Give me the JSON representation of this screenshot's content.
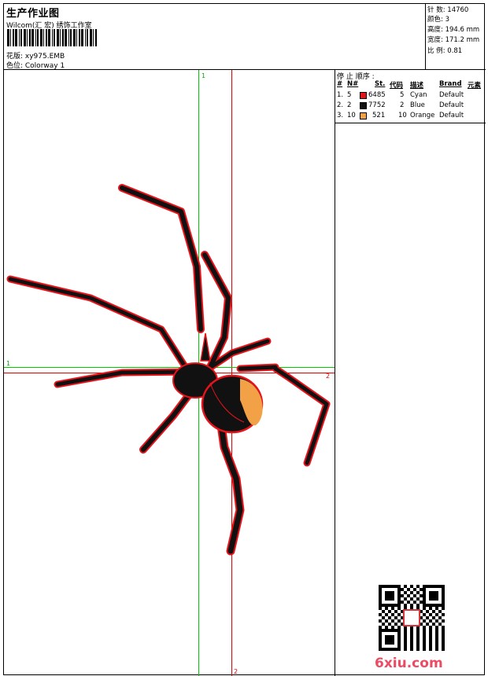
{
  "header": {
    "title": "生产作业图",
    "subtitle": "Wilcom(汇 宏) 绣饰工作室",
    "design_label": "花版: xy975.EMB",
    "colorway_label": "色位:  Colorway 1"
  },
  "stats": [
    {
      "label": "针 数:",
      "value": "14760"
    },
    {
      "label": "颜色:",
      "value": "3"
    },
    {
      "label": "高度:",
      "value": "194.6 mm"
    },
    {
      "label": "宽度:",
      "value": "171.2 mm"
    },
    {
      "label": "比 例:",
      "value": "0.81"
    }
  ],
  "stop_sequence": {
    "title": "停 止 顺序 :",
    "headers": {
      "hash": "#",
      "n": "N#",
      "st": "St.",
      "code": "代码",
      "desc": "描述",
      "brand": "Brand",
      "elem": "元素"
    },
    "rows": [
      {
        "hash": "1.",
        "n": "5",
        "color": "#e5141b",
        "st": "6485",
        "code": "5",
        "desc": "Cyan",
        "brand": "Default"
      },
      {
        "hash": "2.",
        "n": "2",
        "color": "#111111",
        "st": "7752",
        "code": "2",
        "desc": "Blue",
        "brand": "Default"
      },
      {
        "hash": "3.",
        "n": "10",
        "color": "#f2a146",
        "st": "521",
        "code": "10",
        "desc": "Orange",
        "brand": "Default"
      }
    ]
  },
  "axes": {
    "v1": "1",
    "v2": "2",
    "h1": "1",
    "h2": "2"
  },
  "watermark": "6xiu.com",
  "colors": {
    "red": "#e5141b",
    "black": "#111111",
    "orange": "#f2a146",
    "green_axis": "#00cc00",
    "red_axis": "#dd0000"
  }
}
